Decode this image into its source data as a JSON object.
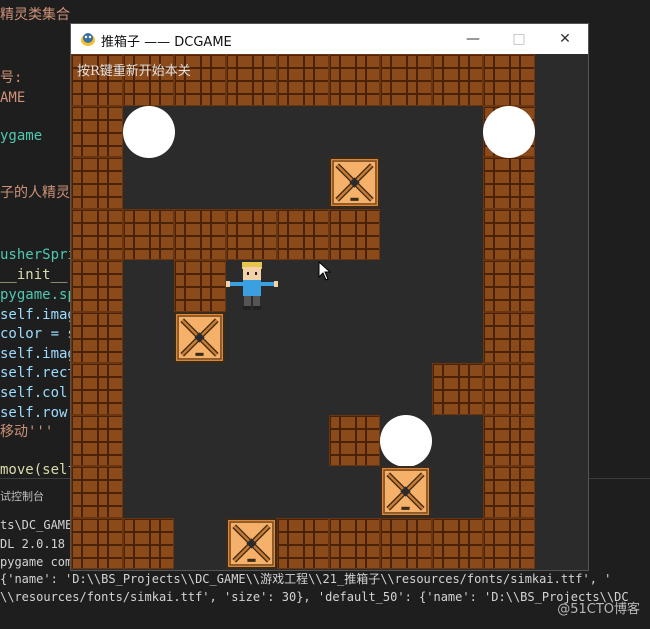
{
  "window": {
    "title": "推箱子 —— DCGAME",
    "minimize": "—",
    "maximize": "□",
    "close": "✕",
    "hint": "按R键重新开始本关"
  },
  "editor": {
    "lines": [
      {
        "text": "精灵类集合",
        "cls": "c-orange"
      },
      {
        "text": "号:",
        "cls": "c-orange"
      },
      {
        "text": "AME",
        "cls": "c-orange"
      },
      {
        "text": "ygame",
        "cls": "c-teal"
      },
      {
        "text": "子的人精灵类",
        "cls": "c-orange"
      },
      {
        "text": "usherSprit",
        "cls": "c-teal"
      },
      {
        "text": "__init__(",
        "cls": "c-yellow"
      },
      {
        "text": "pygame.sp",
        "cls": "c-teal"
      },
      {
        "text": "self.imag",
        "cls": "c-blue"
      },
      {
        "text": "color = s",
        "cls": "c-blue"
      },
      {
        "text": "self.imag",
        "cls": "c-blue"
      },
      {
        "text": "self.rect",
        "cls": "c-blue"
      },
      {
        "text": "self.col",
        "cls": "c-blue"
      },
      {
        "text": "self.row",
        "cls": "c-blue"
      },
      {
        "text": "移动'''",
        "cls": "c-orange"
      },
      {
        "text": "move(self",
        "cls": "c-yellow"
      }
    ],
    "terminal_tab": "试控制台",
    "terminal_lines": [
      "ts\\DC_GAME",
      "DL 2.0.18",
      "pygame com",
      "{'name': 'D:\\\\BS_Projects\\\\DC_GAME\\\\游戏工程\\\\21_推箱子\\\\resources/fonts/simkai.ttf', '",
      "\\\\resources/fonts/simkai.ttf', 'size': 30}, 'default_50': {'name': 'D:\\\\BS_Projects\\\\DC"
    ]
  },
  "watermark": "@51CTO博客",
  "game": {
    "level_map": [
      "#########",
      "#       #",
      "#       #",
      "######  #",
      "# #     #",
      "#       #",
      "#      ##",
      "#    #  #",
      "#       #",
      "##  #####"
    ],
    "goals": [
      [
        1,
        1
      ],
      [
        1,
        8
      ],
      [
        7,
        6
      ]
    ],
    "boxes": [
      [
        2,
        5
      ],
      [
        5,
        2
      ],
      [
        8,
        6
      ],
      [
        9,
        3
      ]
    ],
    "player": [
      4,
      3
    ]
  }
}
